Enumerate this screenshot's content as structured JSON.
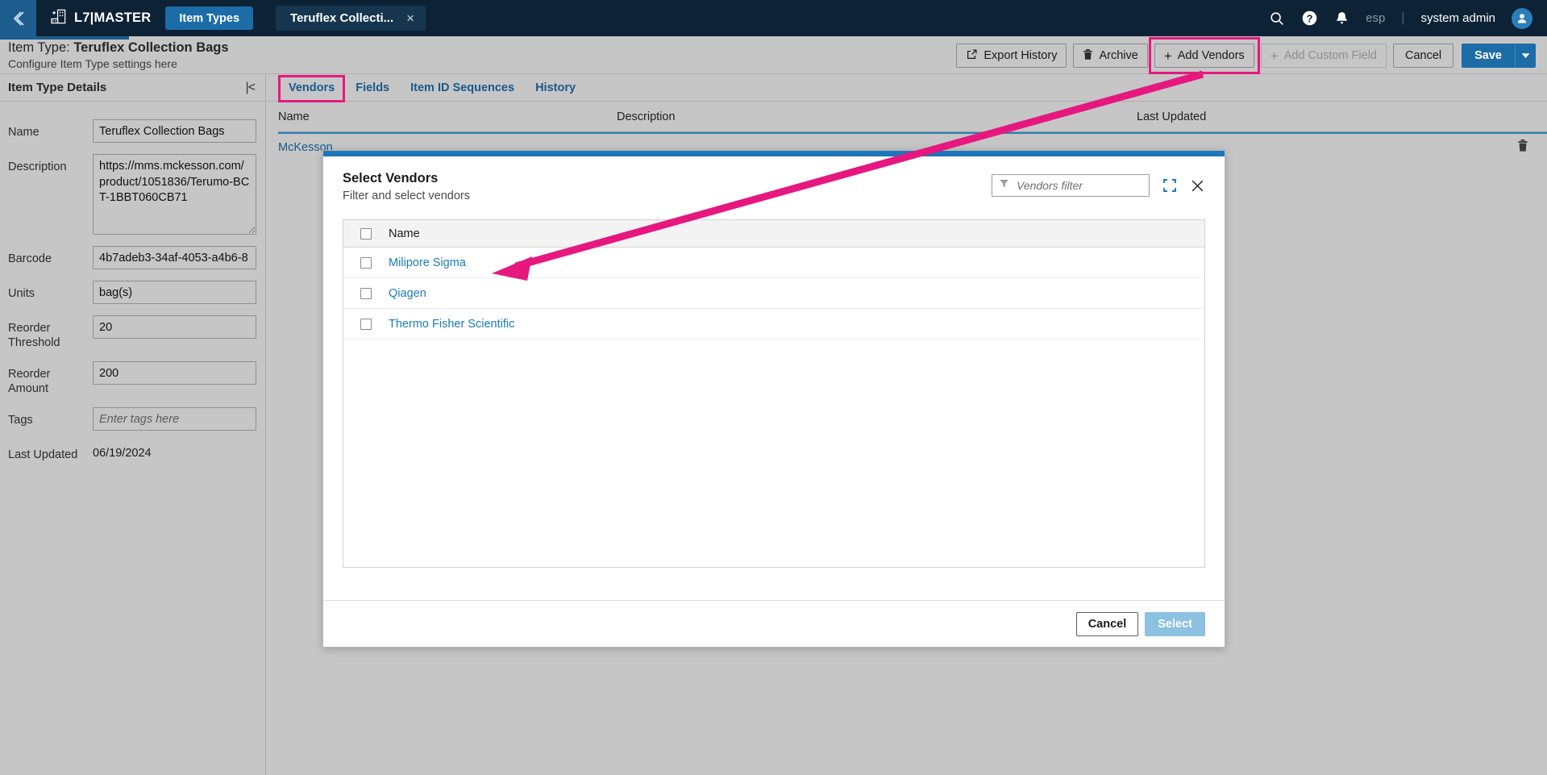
{
  "topbar": {
    "back_icon": "chevron-left-icon",
    "app_icon": "add-building-icon",
    "brand": "L7|MASTER",
    "nav_tab": "Item Types",
    "doc_tab": "Teruflex Collecti...",
    "doc_close": "×",
    "search_icon": "search-icon",
    "help_icon": "help-circle-icon",
    "bell_icon": "bell-icon",
    "locale": "esp",
    "divider": "|",
    "user": "system admin",
    "avatar_icon": "user-avatar-icon"
  },
  "page_header": {
    "title_prefix": "Item Type: ",
    "title_value": "Teruflex Collection Bags",
    "subtitle": "Configure Item Type settings here",
    "actions": {
      "export_history": "Export History",
      "archive": "Archive",
      "add_vendors": "Add Vendors",
      "add_custom_field": "Add Custom Field",
      "cancel": "Cancel",
      "save": "Save",
      "save_caret_icon": "chevron-down-icon",
      "export_icon": "external-link-icon",
      "trash_icon": "trash-icon",
      "plus_icon": "plus-icon"
    }
  },
  "details": {
    "header": "Item Type Details",
    "collapse_icon": "collapse-panel-icon",
    "fields": [
      {
        "label": "Name",
        "value": "Teruflex Collection Bags",
        "placeholder": "",
        "type": "input"
      },
      {
        "label": "Description",
        "value": "https://mms.mckesson.com/product/1051836/Terumo-BCT-1BBT060CB71",
        "placeholder": "",
        "type": "textarea"
      },
      {
        "label": "Barcode",
        "value": "4b7adeb3-34af-4053-a4b6-8",
        "placeholder": "",
        "type": "input"
      },
      {
        "label": "Units",
        "value": "bag(s)",
        "placeholder": "",
        "type": "input"
      },
      {
        "label": "Reorder Threshold",
        "value": "20",
        "placeholder": "",
        "type": "input"
      },
      {
        "label": "Reorder Amount",
        "value": "200",
        "placeholder": "",
        "type": "input"
      },
      {
        "label": "Tags",
        "value": "",
        "placeholder": "Enter tags here",
        "type": "input"
      },
      {
        "label": "Last Updated",
        "value": "06/19/2024",
        "placeholder": "",
        "type": "static"
      }
    ]
  },
  "content": {
    "tabs": [
      {
        "label": "Vendors",
        "active": true
      },
      {
        "label": "Fields",
        "active": false
      },
      {
        "label": "Item ID Sequences",
        "active": false
      },
      {
        "label": "History",
        "active": false
      }
    ],
    "grid": {
      "columns": [
        "Name",
        "Description",
        "Last Updated"
      ],
      "rows": [
        {
          "name": "McKesson",
          "description": "",
          "last_updated": "",
          "delete_icon": "trash-icon"
        }
      ]
    }
  },
  "modal": {
    "title": "Select Vendors",
    "subtitle": "Filter and select vendors",
    "filter_placeholder": "Vendors filter",
    "filter_value": "",
    "filter_icon": "filter-icon",
    "expand_icon": "fullscreen-icon",
    "close_icon": "close-icon",
    "table": {
      "select_all_checkbox": false,
      "columns": [
        "Name"
      ],
      "rows": [
        {
          "name": "Milipore Sigma",
          "checked": false
        },
        {
          "name": "Qiagen",
          "checked": false
        },
        {
          "name": "Thermo Fisher Scientific",
          "checked": false
        }
      ]
    },
    "footer": {
      "cancel": "Cancel",
      "select": "Select",
      "select_disabled": true
    }
  },
  "colors": {
    "topbar_bg": "#0d2235",
    "accent_blue": "#1c6ca8",
    "modal_accent": "#1c77b8",
    "link_blue": "#19598c",
    "annotation_pink": "#e6187f",
    "page_bg": "#c6c6c6",
    "select_disabled": "#8cc1e0"
  }
}
